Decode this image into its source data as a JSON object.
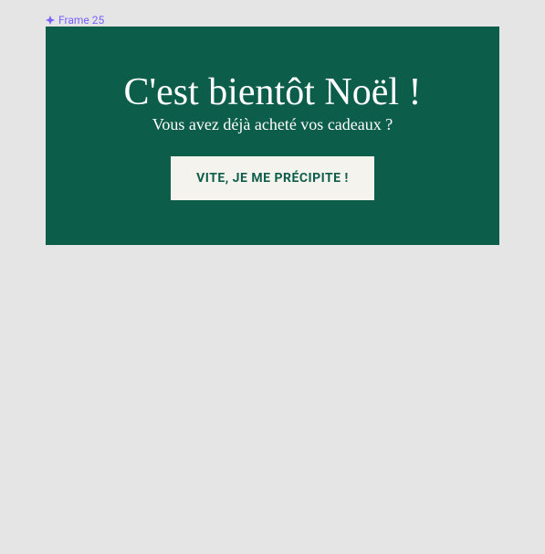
{
  "frame": {
    "label": "Frame 25"
  },
  "banner": {
    "title": "C'est bientôt Noël !",
    "subtitle": "Vous avez déjà acheté vos cadeaux ?",
    "cta_label": "VITE, JE ME PRÉCIPITE !"
  },
  "colors": {
    "banner_bg": "#0d5d4b",
    "button_bg": "#f5f3ee",
    "button_text": "#0d5d4b",
    "frame_label": "#7b61ff"
  }
}
